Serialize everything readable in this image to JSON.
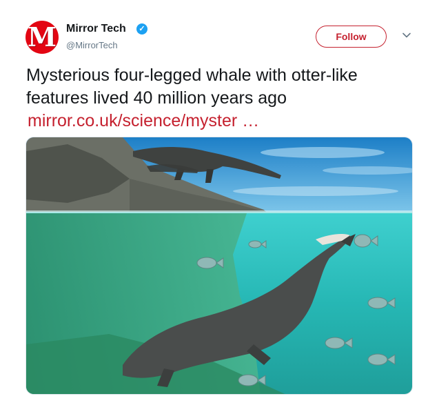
{
  "author": {
    "name": "Mirror Tech",
    "handle": "@MirrorTech",
    "avatar_letter": "M",
    "verified": true,
    "brand_color": "#e30613"
  },
  "actions": {
    "follow_label": "Follow",
    "menu_icon": "chevron-down-icon"
  },
  "tweet": {
    "text": "Mysterious four-legged whale with otter-like features lived 40 million years ago",
    "link": "mirror.co.uk/science/myster …",
    "link_color": "#c5212f"
  },
  "media": {
    "alt": "illustration"
  }
}
